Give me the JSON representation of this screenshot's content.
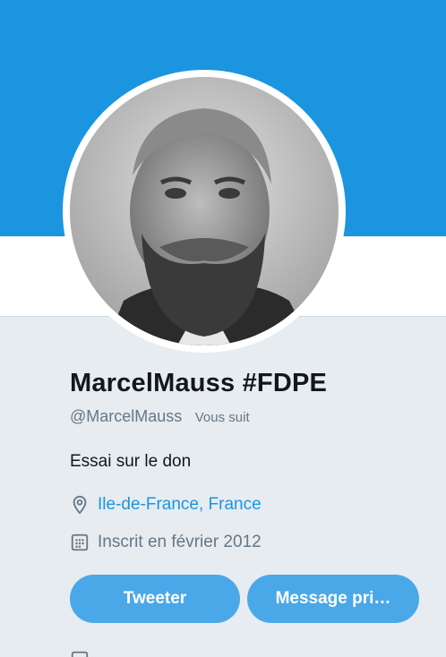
{
  "profile": {
    "display_name": "MarcelMauss #FDPE",
    "handle": "@MarcelMauss",
    "follows_you": "Vous suit",
    "bio": "Essai sur le don",
    "location": "Ile-de-France, France",
    "joined": "Inscrit en février 2012",
    "avatar_description": "portrait photo"
  },
  "actions": {
    "tweet_label": "Tweeter",
    "message_label": "Message pri…"
  },
  "colors": {
    "banner": "#1b95e0",
    "button": "#4aa8e8",
    "link": "#1b95e0",
    "secondary_text": "#657786",
    "background": "#e6ecf0"
  },
  "icons": {
    "location": "location-pin-icon",
    "joined": "calendar-icon",
    "bottom": "media-icon"
  }
}
